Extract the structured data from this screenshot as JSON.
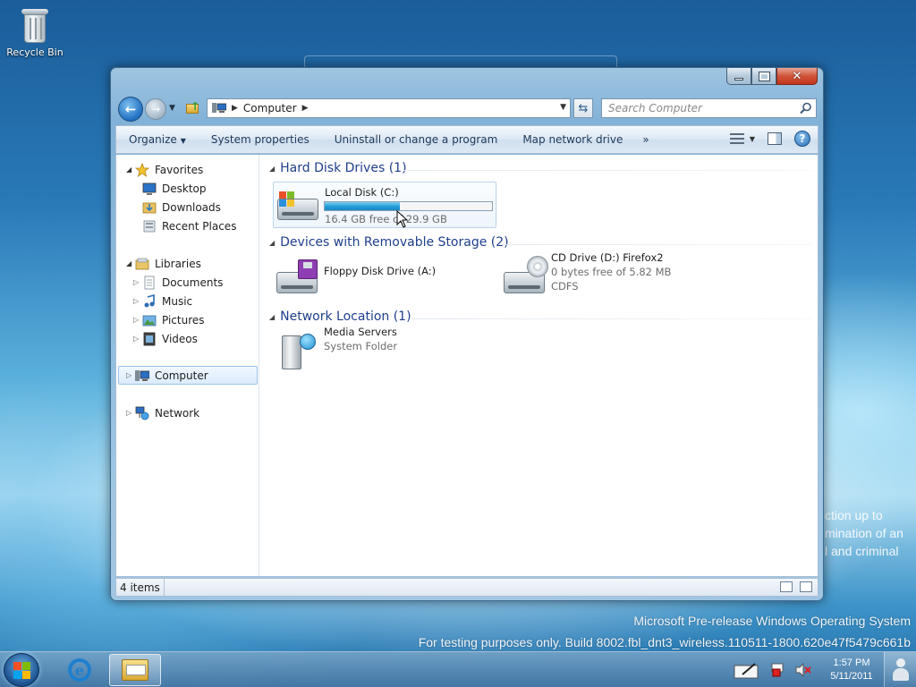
{
  "desktop": {
    "recycle_bin_label": "Recycle Bin",
    "watermark_line1": "Microsoft Pre-release Windows Operating System",
    "watermark_line2": "For testing purposes only. Build 8002.fbl_dnt3_wireless.110511-1800.620e47f5479c661b",
    "background_text": [
      "ction up to",
      "mination of an",
      "l and criminal"
    ]
  },
  "window": {
    "address": {
      "crumb": "Computer"
    },
    "search": {
      "placeholder": "Search Computer"
    },
    "commands": {
      "organize": "Organize",
      "system_properties": "System properties",
      "uninstall": "Uninstall or change a program",
      "map_drive": "Map network drive",
      "more": "»"
    },
    "nav": {
      "favorites": "Favorites",
      "desktop": "Desktop",
      "downloads": "Downloads",
      "recent_places": "Recent Places",
      "libraries": "Libraries",
      "documents": "Documents",
      "music": "Music",
      "pictures": "Pictures",
      "videos": "Videos",
      "computer": "Computer",
      "network": "Network"
    },
    "groups": {
      "hard_disk": "Hard Disk Drives (1)",
      "removable": "Devices with Removable Storage (2)",
      "network": "Network Location (1)"
    },
    "items": {
      "local_disk": {
        "name": "Local Disk (C:)",
        "detail": "16.4 GB free of 29.9 GB",
        "used_fraction": 0.45
      },
      "floppy": {
        "name": "Floppy Disk Drive (A:)"
      },
      "cd_drive": {
        "name": "CD Drive (D:) Firefox2",
        "detail": "0 bytes free of 5.82 MB",
        "fs": "CDFS"
      },
      "media_servers": {
        "name": "Media Servers",
        "detail": "System Folder"
      }
    },
    "status": {
      "item_count": "4 items"
    }
  },
  "taskbar": {
    "time": "1:57 PM",
    "date": "5/11/2011"
  },
  "colors": {
    "group_header": "#1e3f8c",
    "capacity_fill": "#26a0da",
    "selection": "#dcebfc"
  }
}
